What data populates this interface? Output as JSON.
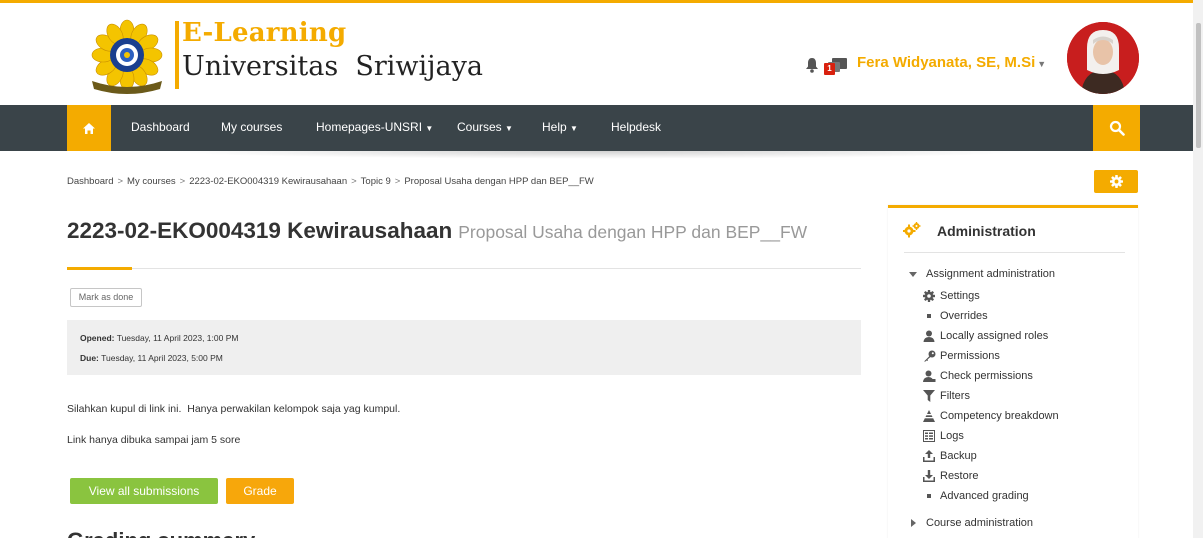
{
  "site": {
    "brand_top": "E-Learning",
    "brand_bottom": "Universitas  Sriwijaya"
  },
  "header": {
    "user_name": "Fera Widyanata, SE, M.Si",
    "message_count": "1"
  },
  "nav": {
    "items": [
      {
        "label": "Dashboard",
        "dropdown": false
      },
      {
        "label": "My courses",
        "dropdown": false
      },
      {
        "label": "Homepages-UNSRI",
        "dropdown": true
      },
      {
        "label": "Courses",
        "dropdown": true
      },
      {
        "label": "Help",
        "dropdown": true
      },
      {
        "label": "Helpdesk",
        "dropdown": false
      }
    ]
  },
  "breadcrumb": [
    "Dashboard",
    "My courses",
    "2223-02-EKO004319 Kewirausahaan",
    "Topic 9",
    "Proposal Usaha dengan HPP dan BEP__FW"
  ],
  "page": {
    "course_title": "2223-02-EKO004319 Kewirausahaan",
    "activity_title": "Proposal Usaha dengan HPP dan BEP__FW",
    "mark_done": "Mark as done",
    "opened_label": "Opened:",
    "opened_value": "Tuesday, 11 April 2023, 1:00 PM",
    "due_label": "Due:",
    "due_value": "Tuesday, 11 April 2023, 5:00 PM",
    "description": [
      "Silahkan kupul di link ini.  Hanya perwakilan kelompok saja yag kumpul.",
      "Link hanya dibuka sampai jam 5 sore"
    ],
    "view_submissions": "View all submissions",
    "grade": "Grade",
    "grading_heading": "Grading summary"
  },
  "admin": {
    "title": "Administration",
    "section": "Assignment administration",
    "items": [
      {
        "label": "Settings",
        "icon": "gear-icon"
      },
      {
        "label": "Overrides",
        "icon": "bullet-icon"
      },
      {
        "label": "Locally assigned roles",
        "icon": "user-icon"
      },
      {
        "label": "Permissions",
        "icon": "key-icon"
      },
      {
        "label": "Check permissions",
        "icon": "user-check-icon"
      },
      {
        "label": "Filters",
        "icon": "filter-icon"
      },
      {
        "label": "Competency breakdown",
        "icon": "competency-icon"
      },
      {
        "label": "Logs",
        "icon": "logs-icon"
      },
      {
        "label": "Backup",
        "icon": "backup-icon"
      },
      {
        "label": "Restore",
        "icon": "restore-icon"
      },
      {
        "label": "Advanced grading",
        "icon": "bullet-icon"
      }
    ],
    "course_admin": "Course administration"
  },
  "colors": {
    "accent": "#f4ab00",
    "nav_bg": "#3a4449",
    "green": "#8ac43f"
  }
}
